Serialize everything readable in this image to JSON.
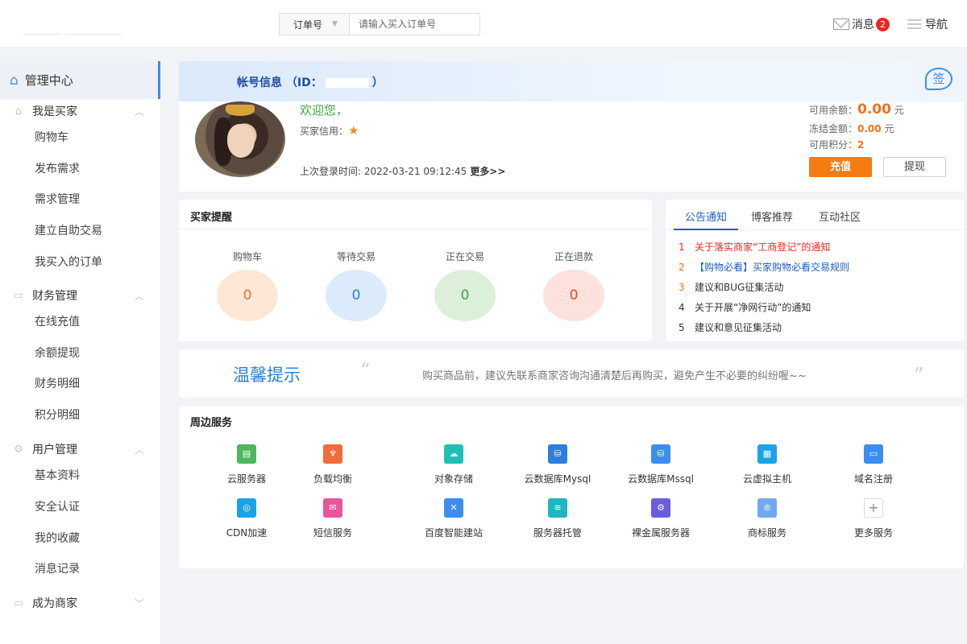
{
  "header": {
    "search_select": "订单号",
    "search_placeholder": "请输入买入订单号",
    "messages_label": "消息",
    "messages_count": "2",
    "nav_label": "导航"
  },
  "sidebar": {
    "active_label": "管理中心",
    "sections": [
      {
        "title": "我是买家",
        "items": [
          "购物车",
          "发布需求",
          "需求管理",
          "建立自助交易",
          "我买入的订单"
        ]
      },
      {
        "title": "财务管理",
        "items": [
          "在线充值",
          "余额提现",
          "财务明细",
          "积分明细"
        ]
      },
      {
        "title": "用户管理",
        "items": [
          "基本资料",
          "安全认证",
          "我的收藏",
          "消息记录"
        ]
      },
      {
        "title": "成为商家",
        "items": []
      }
    ]
  },
  "account": {
    "title_prefix": "帐号信息 （ID：",
    "title_suffix": "）",
    "sign_label": "签",
    "welcome": "欢迎您，",
    "credit_label": "买家信用：",
    "last_login_label": "上次登录时间: 2022-03-21 09:12:45",
    "more_label": "更多>>",
    "available_label": "可用余额：",
    "available_value": "0.00",
    "available_unit": "元",
    "frozen_label": "冻结金额：",
    "frozen_value": "0.00",
    "frozen_unit": "元",
    "points_label": "可用积分：",
    "points_value": "2",
    "recharge_button": "充值",
    "withdraw_button": "提现"
  },
  "reminder": {
    "title": "买家提醒",
    "stats": [
      {
        "label": "购物车",
        "value": "0",
        "bg": "#fde8d8",
        "color": "#f2711c"
      },
      {
        "label": "等待交易",
        "value": "0",
        "bg": "#dcebfc",
        "color": "#2a7fe0"
      },
      {
        "label": "正在交易",
        "value": "0",
        "bg": "#dcefd9",
        "color": "#3aa64a"
      },
      {
        "label": "正在退款",
        "value": "0",
        "bg": "#fde1dc",
        "color": "#e8472f"
      }
    ]
  },
  "notice": {
    "tabs": [
      "公告通知",
      "博客推荐",
      "互动社区"
    ],
    "items": [
      {
        "num": "1",
        "text": "关于落实商家“工商登记”的通知",
        "color": "#e8281f"
      },
      {
        "num": "2",
        "text": "【购物必看】买家购物必看交易规则",
        "color": "#1d5fc2"
      },
      {
        "num": "3",
        "text": "建议和BUG征集活动",
        "color": "#333333"
      },
      {
        "num": "4",
        "text": "关于开展“净网行动”的通知",
        "color": "#333333"
      },
      {
        "num": "5",
        "text": "建议和意见征集活动",
        "color": "#333333"
      }
    ],
    "num_colors": [
      "#e8281f",
      "#f2711c",
      "#f2711c",
      "#333333",
      "#333333"
    ]
  },
  "tip": {
    "title": "温馨提示",
    "quote_open": "“",
    "text": "购买商品前，建议先联系商家咨询沟通清楚后再购买，避免产生不必要的纠纷喔~~",
    "quote_close": "”"
  },
  "services": {
    "title": "周边服务",
    "items": [
      {
        "label": "云服务器",
        "icon": "server-icon",
        "color": "#4db85f",
        "glyph": "▤"
      },
      {
        "label": "负载均衡",
        "icon": "load-balance-icon",
        "color": "#f26b3a",
        "glyph": "♆"
      },
      {
        "label": "对象存储",
        "icon": "cloud-storage-icon",
        "color": "#1fbfb8",
        "glyph": "☁"
      },
      {
        "label": "云数据库Mysql",
        "icon": "mysql-icon",
        "color": "#2a7fe0",
        "glyph": "⛁"
      },
      {
        "label": "云数据库Mssql",
        "icon": "mssql-icon",
        "color": "#3b8ef0",
        "glyph": "⛁"
      },
      {
        "label": "云虚拟主机",
        "icon": "virtual-host-icon",
        "color": "#1aa3e8",
        "glyph": "▦"
      },
      {
        "label": "域名注册",
        "icon": "domain-icon",
        "color": "#3b8ef0",
        "glyph": "▭"
      },
      {
        "label": "CDN加速",
        "icon": "cdn-icon",
        "color": "#1aa3e8",
        "glyph": "◎"
      },
      {
        "label": "短信服务",
        "icon": "sms-icon",
        "color": "#e8559b",
        "glyph": "✉"
      },
      {
        "label": "百度智能建站",
        "icon": "site-builder-icon",
        "color": "#3b8ef0",
        "glyph": "✕"
      },
      {
        "label": "服务器托管",
        "icon": "hosting-icon",
        "color": "#1fb5c2",
        "glyph": "≋"
      },
      {
        "label": "裸金属服务器",
        "icon": "bare-metal-icon",
        "color": "#6a5ce0",
        "glyph": "⚙"
      },
      {
        "label": "商标服务",
        "icon": "trademark-icon",
        "color": "#6fa8f0",
        "glyph": "®"
      },
      {
        "label": "更多服务",
        "icon": "plus-icon",
        "color": "#ffffff",
        "glyph": "+"
      }
    ]
  }
}
